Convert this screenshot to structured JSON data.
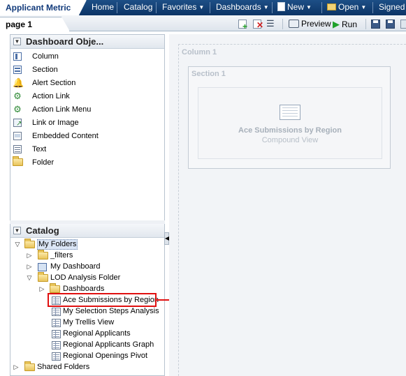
{
  "app_title": "Applicant Metric",
  "nav": {
    "home": "Home",
    "catalog": "Catalog",
    "favorites": "Favorites",
    "dashboards": "Dashboards",
    "new": "New",
    "open": "Open",
    "signed_in": "Signed I"
  },
  "tabs": {
    "page1": "page 1"
  },
  "toolbar": {
    "preview": "Preview",
    "run": "Run"
  },
  "dashboard_objects": {
    "title": "Dashboard Obje...",
    "items": [
      {
        "label": "Column",
        "icon": "column-icon"
      },
      {
        "label": "Section",
        "icon": "section-icon"
      },
      {
        "label": "Alert Section",
        "icon": "bell-icon"
      },
      {
        "label": "Action Link",
        "icon": "gear-icon"
      },
      {
        "label": "Action Link Menu",
        "icon": "gear-menu-icon"
      },
      {
        "label": "Link or Image",
        "icon": "link-icon"
      },
      {
        "label": "Embedded Content",
        "icon": "embed-icon"
      },
      {
        "label": "Text",
        "icon": "text-icon"
      },
      {
        "label": "Folder",
        "icon": "folder-icon"
      }
    ]
  },
  "catalog": {
    "title": "Catalog",
    "tree": [
      {
        "label": "My Folders"
      },
      {
        "label": "_filters"
      },
      {
        "label": "My Dashboard"
      },
      {
        "label": "LOD Analysis Folder"
      },
      {
        "label": "Dashboards"
      },
      {
        "label": "Ace Submissions by Region"
      },
      {
        "label": "My Selection Steps Analysis"
      },
      {
        "label": "My Trellis View"
      },
      {
        "label": "Regional Applicants"
      },
      {
        "label": "Regional Applicants Graph"
      },
      {
        "label": "Regional Openings Pivot"
      },
      {
        "label": "Shared Folders"
      }
    ]
  },
  "canvas": {
    "column_label": "Column 1",
    "section_label": "Section 1",
    "view_title": "Ace Submissions by Region",
    "view_type": "Compound View"
  },
  "colors": {
    "accent": "#0c3466",
    "highlight": "#e01010"
  }
}
